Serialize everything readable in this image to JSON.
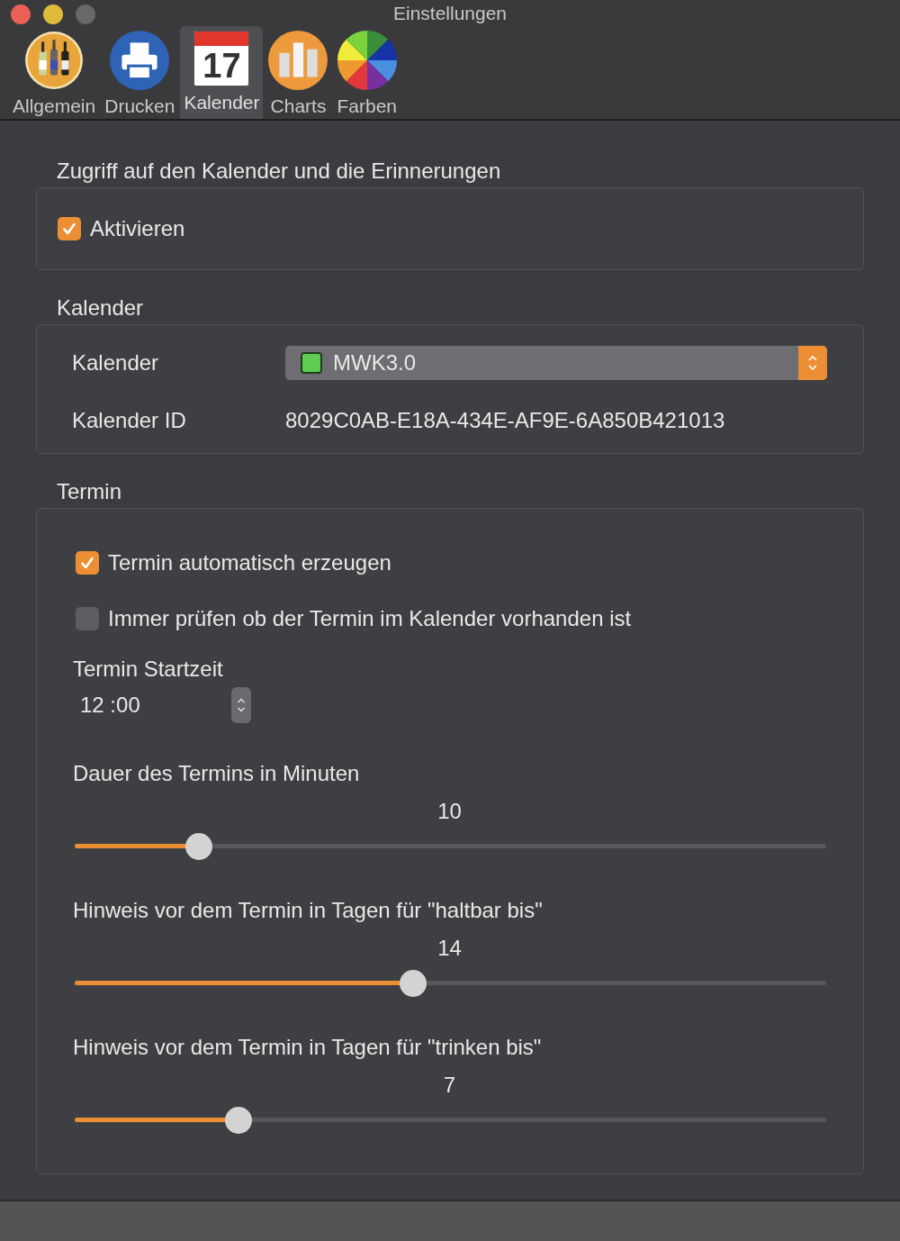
{
  "window": {
    "title": "Einstellungen"
  },
  "tabs": [
    {
      "label": "Allgemein",
      "kind": "bottles",
      "selected": false
    },
    {
      "label": "Drucken",
      "kind": "printer",
      "selected": false
    },
    {
      "label": "Kalender",
      "kind": "calendar",
      "day": "17",
      "selected": true
    },
    {
      "label": "Charts",
      "kind": "chart",
      "selected": false
    },
    {
      "label": "Farben",
      "kind": "colors",
      "selected": false
    }
  ],
  "access": {
    "title": "Zugriff auf den Kalender und die Erinnerungen",
    "checkbox": {
      "label": "Aktivieren",
      "checked": true
    }
  },
  "calendar": {
    "title": "Kalender",
    "rows": [
      {
        "label": "Kalender",
        "kind": "popup",
        "value": "MWK3.0",
        "color": "#5ecb53"
      },
      {
        "label": "Kalender ID",
        "kind": "text",
        "value": "8029C0AB-E18A-434E-AF9E-6A850B421013"
      }
    ]
  },
  "appointment": {
    "title": "Termin",
    "checkboxes": [
      {
        "label": "Termin automatisch erzeugen",
        "checked": true
      },
      {
        "label": "Immer prüfen ob der Termin im Kalender vorhanden ist",
        "checked": false
      }
    ],
    "start_time": {
      "label": "Termin Startzeit",
      "value": "12 :00"
    },
    "sliders": [
      {
        "label": "Dauer des Termins in Minuten",
        "reading": "10",
        "level": 0.165
      },
      {
        "label": "Hinweis vor dem Termin in Tagen für \"haltbar bis\"",
        "reading": "14",
        "level": 0.45
      },
      {
        "label": "Hinweis vor dem Termin in Tagen für \"trinken bis\"",
        "reading": "7",
        "level": 0.218
      }
    ]
  }
}
